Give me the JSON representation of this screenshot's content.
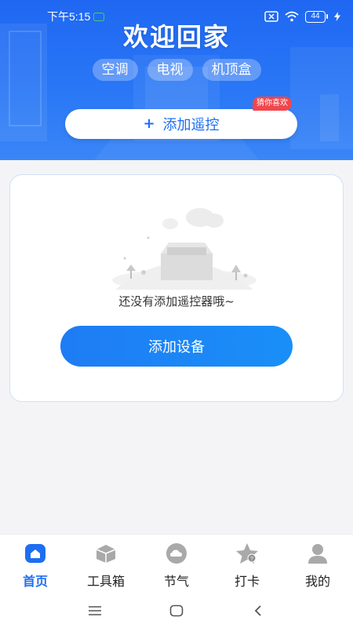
{
  "status": {
    "time": "下午5:15",
    "battery": "44"
  },
  "hero": {
    "title": "欢迎回家",
    "chips": [
      "空调",
      "电视",
      "机顶盒"
    ],
    "add_remote_label": "添加遥控",
    "badge": "猜你喜欢"
  },
  "card": {
    "empty_text": "还没有添加遥控器哦~",
    "add_device_label": "添加设备"
  },
  "nav": {
    "items": [
      {
        "label": "首页",
        "icon": "home-icon",
        "active": true
      },
      {
        "label": "工具箱",
        "icon": "toolbox-icon",
        "active": false
      },
      {
        "label": "节气",
        "icon": "weather-cloud-icon",
        "active": false
      },
      {
        "label": "打卡",
        "icon": "star-checkin-icon",
        "active": false
      },
      {
        "label": "我的",
        "icon": "user-icon",
        "active": false
      }
    ]
  },
  "colors": {
    "accent": "#1e6ef2",
    "hero_blue": "#2a78f6",
    "badge_red": "#f2464b",
    "inactive_icon": "#a9a9a9"
  }
}
